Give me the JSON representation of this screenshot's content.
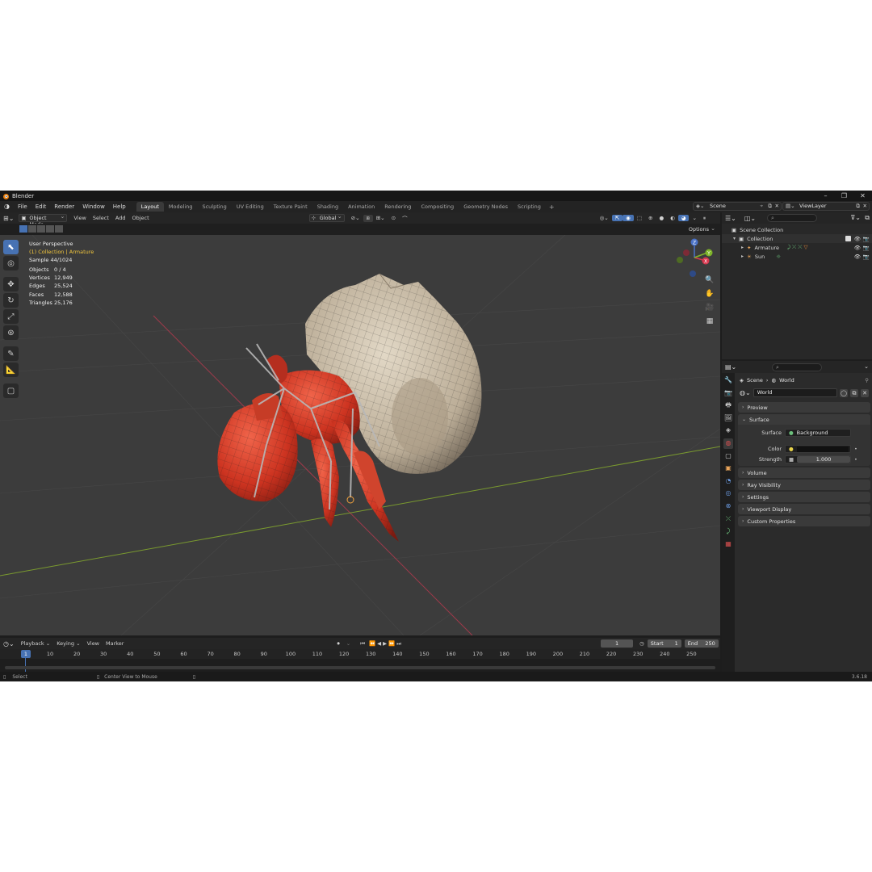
{
  "window": {
    "title": "Blender",
    "controls": [
      "–",
      "❐",
      "✕"
    ]
  },
  "menu": [
    "File",
    "Edit",
    "Render",
    "Window",
    "Help"
  ],
  "workspaces": [
    "Layout",
    "Modeling",
    "Sculpting",
    "UV Editing",
    "Texture Paint",
    "Shading",
    "Animation",
    "Rendering",
    "Compositing",
    "Geometry Nodes",
    "Scripting"
  ],
  "active_workspace": "Layout",
  "scene_name": "Scene",
  "view_layer": "ViewLayer",
  "viewport_header": {
    "mode": "Object Mode",
    "menus": [
      "View",
      "Select",
      "Add",
      "Object"
    ],
    "transform_orientation": "Global",
    "options_label": "Options"
  },
  "viewport_overlay": {
    "perspective": "User Perspective",
    "collection_line_prefix": "(1) Collection | ",
    "active_object": "Armature",
    "sample": "Sample 44/1024",
    "stats": [
      {
        "label": "Objects",
        "value": "0 / 4"
      },
      {
        "label": "Vertices",
        "value": "12,949"
      },
      {
        "label": "Edges",
        "value": "25,524"
      },
      {
        "label": "Faces",
        "value": "12,588"
      },
      {
        "label": "Triangles",
        "value": "25,176"
      }
    ]
  },
  "gizmo_axes": {
    "x": "X",
    "y": "Y",
    "z": "Z"
  },
  "timeline": {
    "menus": [
      "Playback",
      "Keying",
      "View",
      "Marker"
    ],
    "current_frame": "1",
    "start_label": "Start",
    "start": "1",
    "end_label": "End",
    "end": "250",
    "ticks": [
      "10",
      "20",
      "30",
      "40",
      "50",
      "60",
      "70",
      "80",
      "90",
      "100",
      "110",
      "120",
      "130",
      "140",
      "150",
      "160",
      "170",
      "180",
      "190",
      "200",
      "210",
      "220",
      "230",
      "240",
      "250"
    ],
    "marker_label": "1"
  },
  "statusbar": {
    "left": "Select",
    "middle": "Center View to Mouse",
    "version": "3.6.18"
  },
  "outliner": {
    "root": "Scene Collection",
    "collection": "Collection",
    "items": [
      "Armature",
      "Sun"
    ]
  },
  "properties": {
    "breadcrumb_scene": "Scene",
    "breadcrumb_world": "World",
    "world_name": "World",
    "panels_closed_top": [
      "Preview"
    ],
    "surface_panel": "Surface",
    "surface_label": "Surface",
    "surface_value": "Background",
    "color_label": "Color",
    "strength_label": "Strength",
    "strength_value": "1.000",
    "panels_closed_bottom": [
      "Volume",
      "Ray Visibility",
      "Settings",
      "Viewport Display",
      "Custom Properties"
    ]
  },
  "colors": {
    "accent": "#4772b3",
    "active_text": "#f3c73d",
    "x_axis": "#a03a4b",
    "y_axis": "#7a9a2f",
    "crab_red": "#d8442e",
    "shell": "#cfc2ad"
  }
}
